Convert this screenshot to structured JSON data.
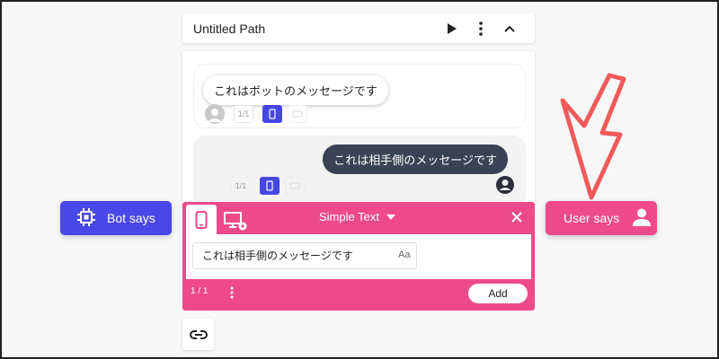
{
  "path": {
    "title": "Untitled Path"
  },
  "messages": {
    "bot_text": "これはボットのメッセージです",
    "bot_counter": "1/1",
    "user_text": "これは相手側のメッセージです",
    "user_counter": "1/1"
  },
  "buttons": {
    "bot_says": "Bot says",
    "user_says": "User says"
  },
  "editor": {
    "type_label": "Simple Text",
    "input_value": "これは相手側のメッセージです",
    "format_label": "Aa",
    "counter": "1 / 1",
    "add_label": "Add"
  },
  "colors": {
    "bot_accent": "#4a47e8",
    "user_accent": "#ee4a8a",
    "user_bubble": "#3a4356",
    "annotation_arrow": "#f05a5a"
  }
}
